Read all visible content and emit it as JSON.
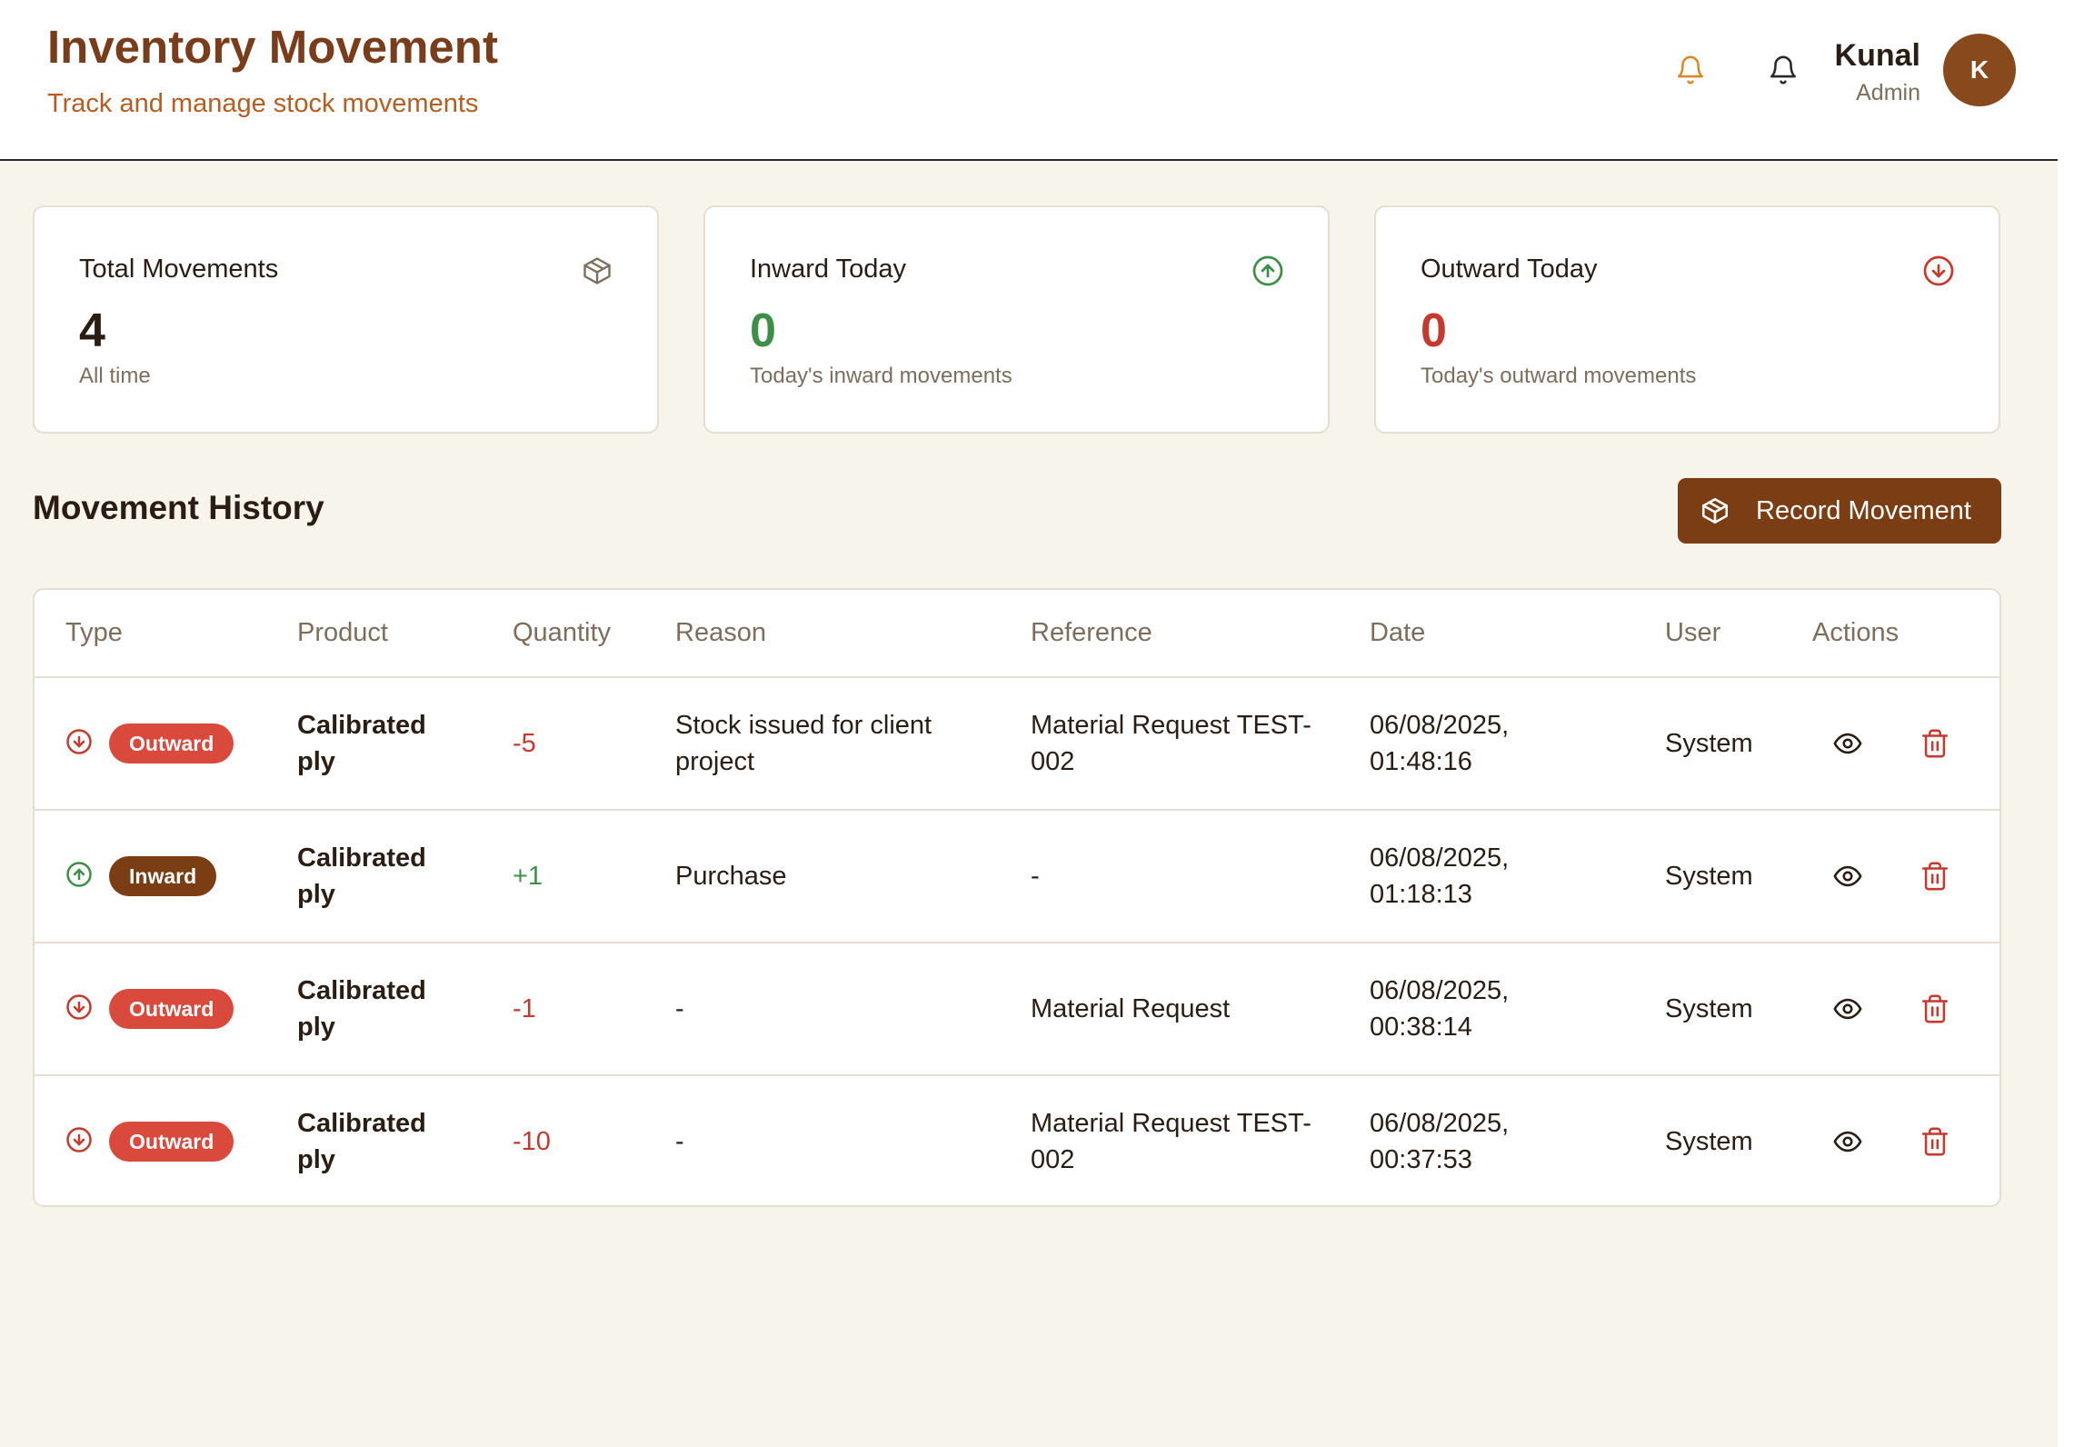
{
  "header": {
    "title": "Inventory Movement",
    "subtitle": "Track and manage stock movements",
    "user_name": "Kunal",
    "user_role": "Admin",
    "avatar_initial": "K",
    "icons": [
      "bell-icon",
      "bell-icon"
    ]
  },
  "stats": [
    {
      "label": "Total Movements",
      "value": "4",
      "sub": "All time",
      "icon": "package-icon",
      "color": "#2a1d14"
    },
    {
      "label": "Inward Today",
      "value": "0",
      "sub": "Today's inward movements",
      "icon": "arrow-up-circle-icon",
      "color": "#3d8f48"
    },
    {
      "label": "Outward Today",
      "value": "0",
      "sub": "Today's outward movements",
      "icon": "arrow-down-circle-icon",
      "color": "#c53a2f"
    }
  ],
  "history": {
    "title": "Movement History",
    "record_button": "Record Movement",
    "columns": [
      "Type",
      "Product",
      "Quantity",
      "Reason",
      "Reference",
      "Date",
      "User",
      "Actions"
    ],
    "rows": [
      {
        "type": "Outward",
        "product": "Calibrated ply",
        "quantity": "-5",
        "reason": "Stock issued for client project",
        "reference": "Material Request TEST-002",
        "date": "06/08/2025, 01:48:16",
        "user": "System"
      },
      {
        "type": "Inward",
        "product": "Calibrated ply",
        "quantity": "+1",
        "reason": "Purchase",
        "reference": "-",
        "date": "06/08/2025, 01:18:13",
        "user": "System"
      },
      {
        "type": "Outward",
        "product": "Calibrated ply",
        "quantity": "-1",
        "reason": "-",
        "reference": "Material Request",
        "date": "06/08/2025, 00:38:14",
        "user": "System"
      },
      {
        "type": "Outward",
        "product": "Calibrated ply",
        "quantity": "-10",
        "reason": "-",
        "reference": "Material Request TEST-002",
        "date": "06/08/2025, 00:37:53",
        "user": "System"
      }
    ]
  },
  "colors": {
    "brand": "#7a3d1c",
    "accent_orange": "#b35e22",
    "inward_green": "#3d8f48",
    "outward_red": "#c53a2f",
    "badge_outward": "#d94a3d",
    "badge_inward": "#7a3d14"
  }
}
